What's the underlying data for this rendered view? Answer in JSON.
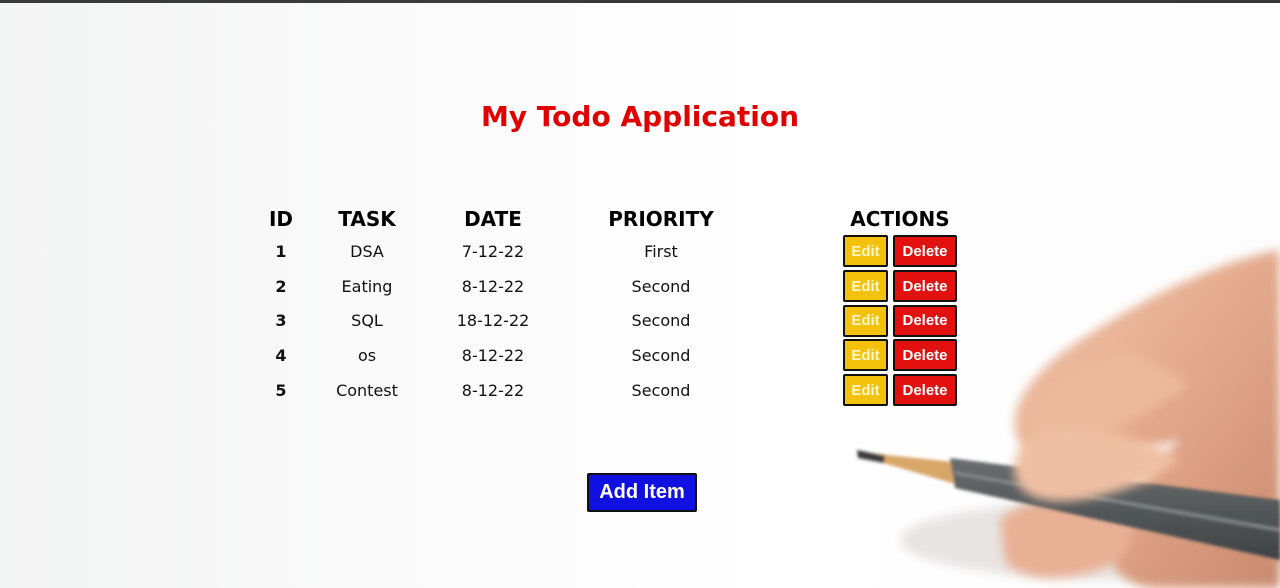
{
  "app": {
    "title": "My Todo Application"
  },
  "table": {
    "headers": {
      "id": "ID",
      "task": "TASK",
      "date": "DATE",
      "priority": "PRIORITY",
      "actions": "ACTIONS"
    },
    "rows": [
      {
        "id": "1",
        "task": "DSA",
        "date": "7-12-22",
        "priority": "First",
        "edit": "Edit",
        "delete": "Delete"
      },
      {
        "id": "2",
        "task": "Eating",
        "date": "8-12-22",
        "priority": "Second",
        "edit": "Edit",
        "delete": "Delete"
      },
      {
        "id": "3",
        "task": "SQL",
        "date": "18-12-22",
        "priority": "Second",
        "edit": "Edit",
        "delete": "Delete"
      },
      {
        "id": "4",
        "task": "os",
        "date": "8-12-22",
        "priority": "Second",
        "edit": "Edit",
        "delete": "Delete"
      },
      {
        "id": "5",
        "task": "Contest",
        "date": "8-12-22",
        "priority": "Second",
        "edit": "Edit",
        "delete": "Delete"
      }
    ]
  },
  "add_button": {
    "label": "Add Item"
  },
  "colors": {
    "title": "#e00000",
    "edit_button": "#f4c20d",
    "delete_button": "#e31010",
    "add_button": "#1010e0"
  },
  "background": {
    "image": "hand-holding-pencil"
  }
}
